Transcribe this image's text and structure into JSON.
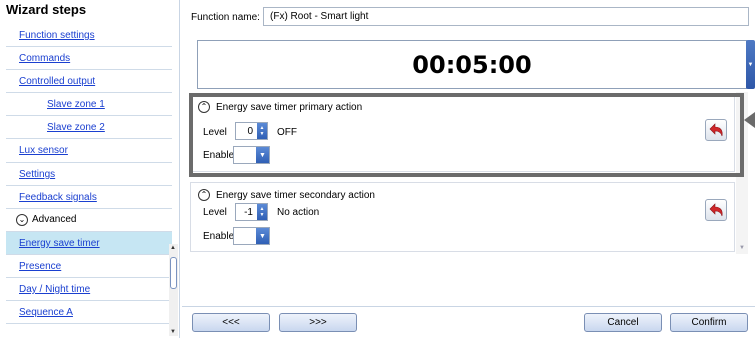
{
  "sidebar": {
    "title": "Wizard steps",
    "items": [
      {
        "label": "Function settings"
      },
      {
        "label": "Commands"
      },
      {
        "label": "Controlled output"
      },
      {
        "label": "Slave zone 1"
      },
      {
        "label": "Slave zone 2"
      },
      {
        "label": "Lux sensor"
      },
      {
        "label": "Settings"
      },
      {
        "label": "Feedback signals"
      },
      {
        "label": "Advanced"
      },
      {
        "label": "Energy save timer"
      },
      {
        "label": "Presence"
      },
      {
        "label": "Day / Night time"
      },
      {
        "label": "Sequence A"
      }
    ]
  },
  "main": {
    "function_name_label": "Function name:",
    "function_name_value": "(Fx) Root - Smart light",
    "timer_value": "00:05:00",
    "primary": {
      "header": "Energy save timer primary action",
      "level_label": "Level",
      "level_value": "0",
      "level_text": "OFF",
      "enable_label": "Enable"
    },
    "secondary": {
      "header": "Energy save timer secondary action",
      "level_label": "Level",
      "level_value": "-1",
      "level_text": "No action",
      "enable_label": "Enable"
    }
  },
  "footer": {
    "prev_label": "<<<",
    "next_label": ">>>",
    "cancel_label": "Cancel",
    "confirm_label": "Confirm"
  },
  "colors": {
    "link": "#1a3fd0",
    "selected_row": "#c6e6f3",
    "highlight_frame": "#6b6b6b",
    "undo_red": "#d0262a",
    "button_blue": "#2f5fb5"
  }
}
